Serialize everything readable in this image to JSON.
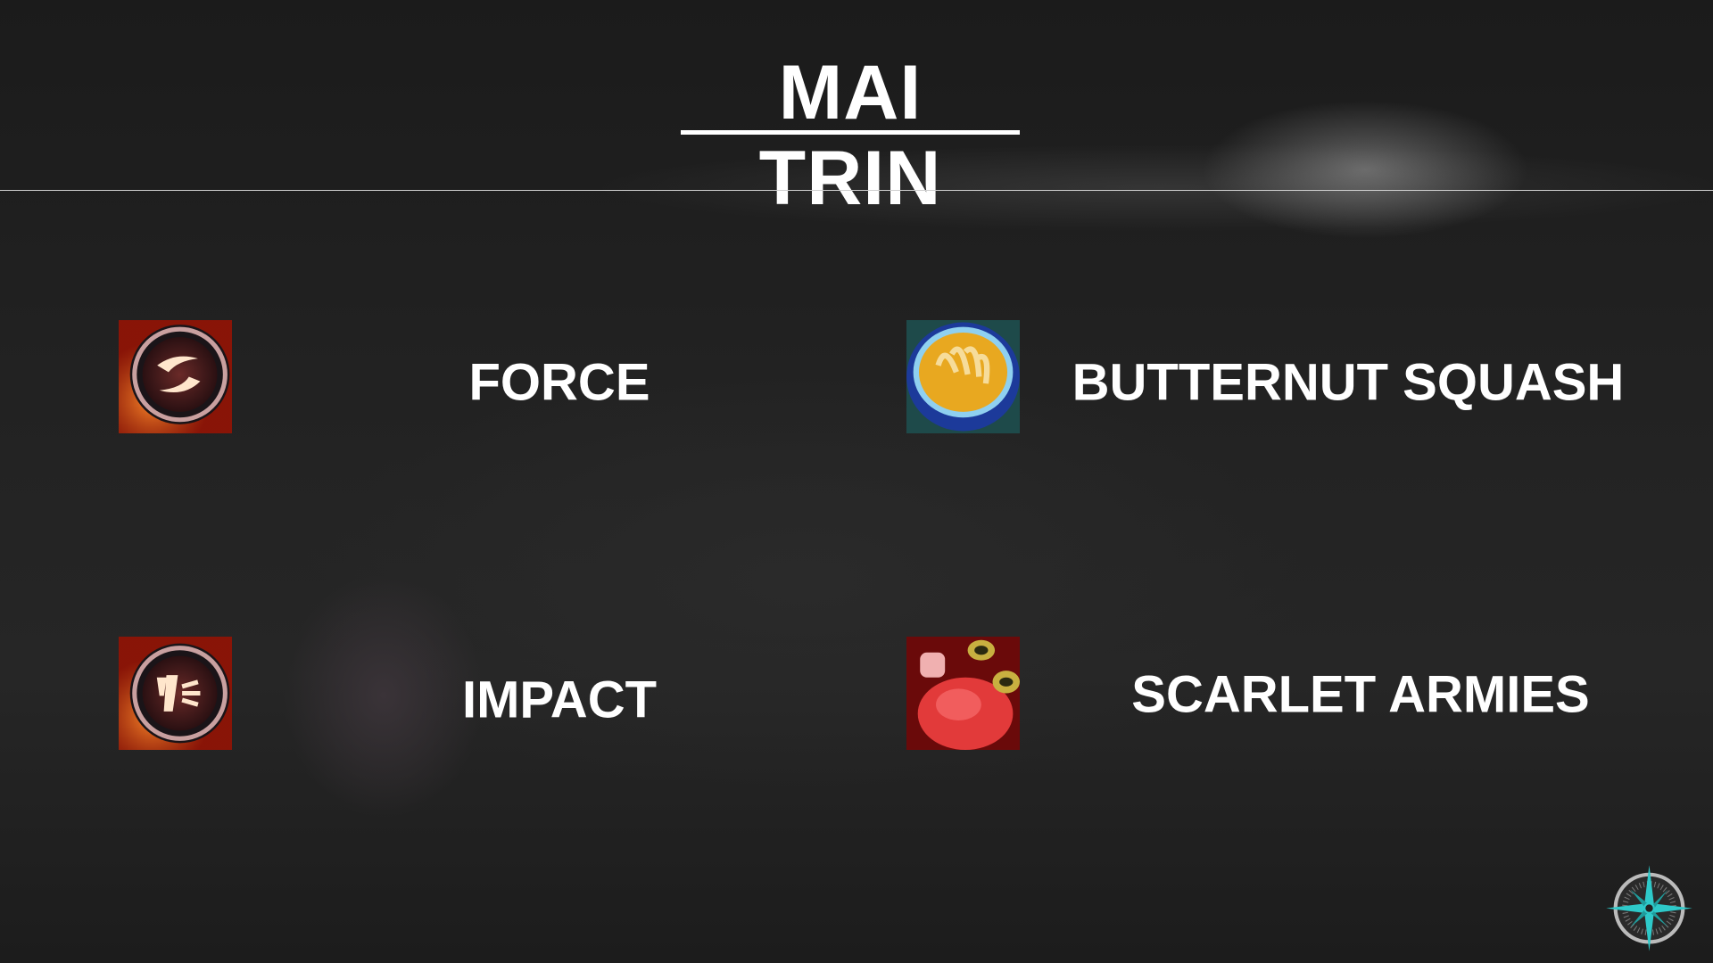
{
  "title": "MAI TRIN",
  "items": [
    {
      "label": "FORCE",
      "icon": "force-sigil-icon"
    },
    {
      "label": "BUTTERNUT SQUASH",
      "icon": "butternut-squash-soup-icon"
    },
    {
      "label": "IMPACT",
      "icon": "impact-sigil-icon"
    },
    {
      "label": "SCARLET ARMIES",
      "icon": "scarlet-armies-potion-icon"
    }
  ],
  "colors": {
    "text": "#ffffff",
    "accent": "#2ec9c9"
  }
}
